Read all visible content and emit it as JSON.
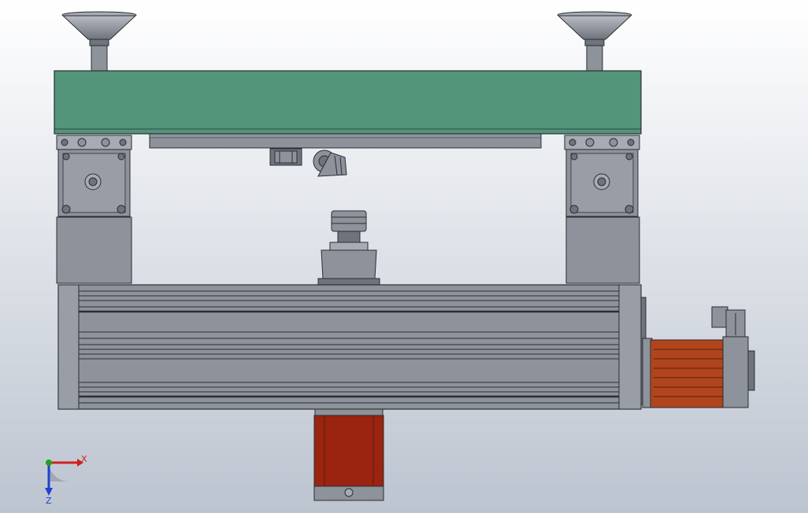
{
  "viewport": {
    "background_top": "#ffffff",
    "background_bottom": "#bcc4d0"
  },
  "colors": {
    "table_top": "#52957a",
    "steel": "#8e929b",
    "steel_dark": "#6f737c",
    "steel_light": "#a7abb3",
    "outline": "#2a2d33",
    "motor_copper": "#b0451d",
    "motor_red": "#9a2410",
    "axis_x": "#d12020",
    "axis_y": "#20a020",
    "axis_z": "#2040d0"
  },
  "triad": {
    "x_label": "X",
    "z_label": "Z",
    "x_icon": "x-axis-arrow-icon",
    "y_icon": "y-axis-dot-icon",
    "z_icon": "z-axis-arrow-icon"
  }
}
